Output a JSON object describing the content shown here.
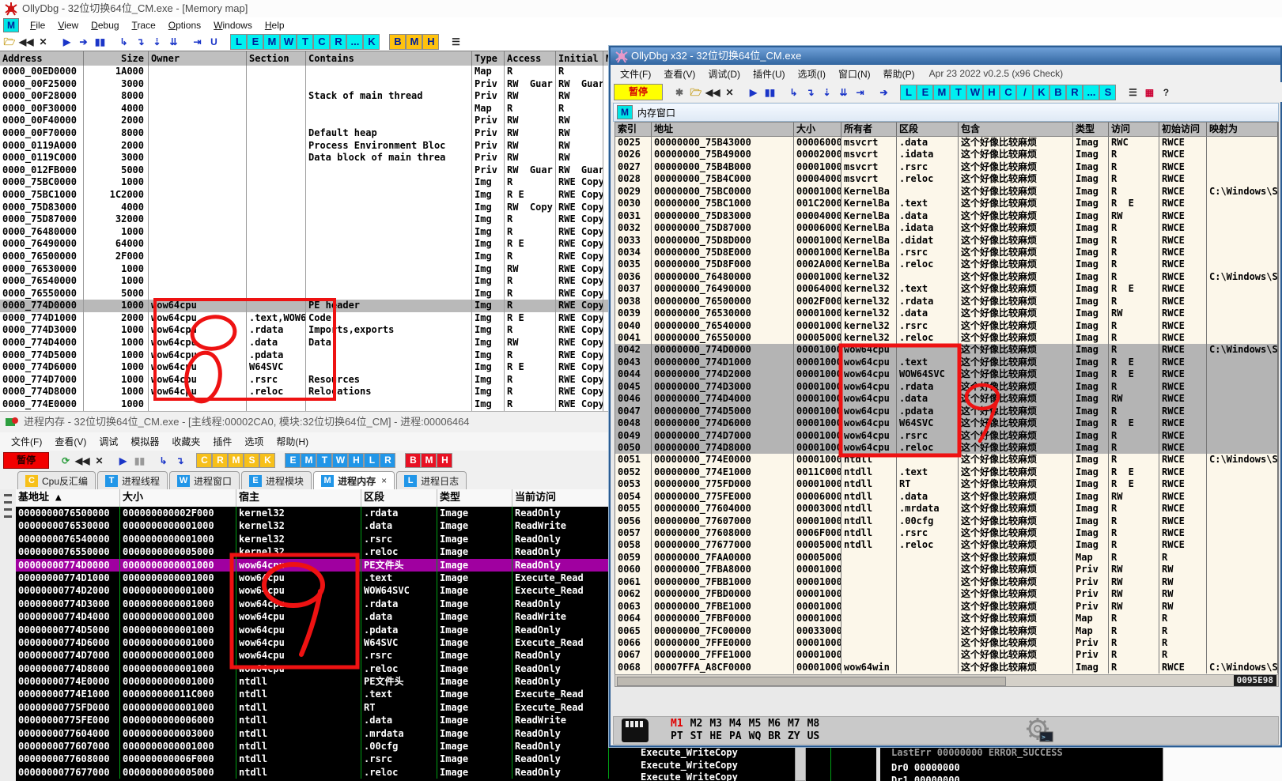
{
  "window_a": {
    "title": "OllyDbg - 32位切换64位_CM.exe - [Memory map]",
    "mdi_button": "M",
    "menu": [
      "File",
      "View",
      "Debug",
      "Trace",
      "Options",
      "Windows",
      "Help"
    ],
    "btn_cyan": [
      "L",
      "E",
      "M",
      "W",
      "T",
      "C",
      "R",
      "...",
      "K"
    ],
    "btn_yellow": [
      "B",
      "M",
      "H"
    ],
    "columns": [
      "Address",
      "Size",
      "Owner",
      "Section",
      "Contains",
      "Type",
      "Access",
      "Initial",
      "Ma"
    ],
    "selected": [
      19
    ],
    "rows": [
      [
        "0000_00ED0000",
        "1A000",
        "",
        "",
        "",
        "Map",
        "R",
        "R"
      ],
      [
        "0000_00F25000",
        "3000",
        "",
        "",
        "",
        "Priv",
        "RW  Guar",
        "RW  Guar"
      ],
      [
        "0000_00F28000",
        "8000",
        "",
        "",
        "Stack of main thread",
        "Priv",
        "RW",
        "RW"
      ],
      [
        "0000_00F30000",
        "4000",
        "",
        "",
        "",
        "Map",
        "R",
        "R"
      ],
      [
        "0000_00F40000",
        "2000",
        "",
        "",
        "",
        "Priv",
        "RW",
        "RW"
      ],
      [
        "0000_00F70000",
        "8000",
        "",
        "",
        "Default heap",
        "Priv",
        "RW",
        "RW"
      ],
      [
        "0000_0119A000",
        "2000",
        "",
        "",
        "Process Environment Bloc",
        "Priv",
        "RW",
        "RW"
      ],
      [
        "0000_0119C000",
        "3000",
        "",
        "",
        "Data block of main threa",
        "Priv",
        "RW",
        "RW"
      ],
      [
        "0000_012FB000",
        "5000",
        "",
        "",
        "",
        "Priv",
        "RW  Guar",
        "RW  Guar"
      ],
      [
        "0000_75BC0000",
        "1000",
        "",
        "",
        "",
        "Img",
        "R",
        "RWE Copy"
      ],
      [
        "0000_75BC1000",
        "1C2000",
        "",
        "",
        "",
        "Img",
        "R E",
        "RWE Copy"
      ],
      [
        "0000_75D83000",
        "4000",
        "",
        "",
        "",
        "Img",
        "RW  Copy",
        "RWE Copy"
      ],
      [
        "0000_75D87000",
        "32000",
        "",
        "",
        "",
        "Img",
        "R",
        "RWE Copy"
      ],
      [
        "0000_76480000",
        "1000",
        "",
        "",
        "",
        "Img",
        "R",
        "RWE Copy"
      ],
      [
        "0000_76490000",
        "64000",
        "",
        "",
        "",
        "Img",
        "R E",
        "RWE Copy"
      ],
      [
        "0000_76500000",
        "2F000",
        "",
        "",
        "",
        "Img",
        "R",
        "RWE Copy"
      ],
      [
        "0000_76530000",
        "1000",
        "",
        "",
        "",
        "Img",
        "RW",
        "RWE Copy"
      ],
      [
        "0000_76540000",
        "1000",
        "",
        "",
        "",
        "Img",
        "R",
        "RWE Copy"
      ],
      [
        "0000_76550000",
        "5000",
        "",
        "",
        "",
        "Img",
        "R",
        "RWE Copy"
      ],
      [
        "0000_774D0000",
        "1000",
        "wow64cpu",
        "",
        "PE header",
        "Img",
        "R",
        "RWE Copy"
      ],
      [
        "0000_774D1000",
        "2000",
        "wow64cpu",
        ".text,WOW6",
        "Code",
        "Img",
        "R E",
        "RWE Copy"
      ],
      [
        "0000_774D3000",
        "1000",
        "wow64cpu",
        ".rdata",
        "Imports,exports",
        "Img",
        "R",
        "RWE Copy"
      ],
      [
        "0000_774D4000",
        "1000",
        "wow64cpu",
        ".data",
        "Data",
        "Img",
        "RW",
        "RWE Copy"
      ],
      [
        "0000_774D5000",
        "1000",
        "wow64cpu",
        ".pdata",
        "",
        "Img",
        "R",
        "RWE Copy"
      ],
      [
        "0000_774D6000",
        "1000",
        "wow64cpu",
        "W64SVC",
        "",
        "Img",
        "R E",
        "RWE Copy"
      ],
      [
        "0000_774D7000",
        "1000",
        "wow64cpu",
        ".rsrc",
        "Resources",
        "Img",
        "R",
        "RWE Copy"
      ],
      [
        "0000_774D8000",
        "1000",
        "wow64cpu",
        ".reloc",
        "Relocations",
        "Img",
        "R",
        "RWE Copy"
      ],
      [
        "0000_774E0000",
        "1000",
        "",
        "",
        "",
        "Img",
        "R",
        "RWE Copy"
      ]
    ]
  },
  "window_b": {
    "title": "进程内存 - 32位切换64位_CM.exe - [主线程:00002CA0, 模块:32位切换64位_CM] - 进程:00006464",
    "menu": [
      "文件(F)",
      "查看(V)",
      "调试",
      "模拟器",
      "收藏夹",
      "插件",
      "选项",
      "帮助(H)"
    ],
    "pause_label": "暂停",
    "btn_yellow": [
      "C",
      "R",
      "M",
      "S",
      "K"
    ],
    "btn_blue": [
      "E",
      "M",
      "T",
      "W",
      "H",
      "L",
      "R"
    ],
    "btn_red": [
      "B",
      "M",
      "H"
    ],
    "back_arrow": "◁",
    "tabs": [
      {
        "letter": "C",
        "label": "Cpu反汇编",
        "color": "yel"
      },
      {
        "letter": "T",
        "label": "进程线程",
        "color": "blu"
      },
      {
        "letter": "W",
        "label": "进程窗口",
        "color": "blu"
      },
      {
        "letter": "E",
        "label": "进程模块",
        "color": "blu"
      },
      {
        "letter": "M",
        "label": "进程内存",
        "color": "blu"
      },
      {
        "letter": "L",
        "label": "进程日志",
        "color": "blu"
      }
    ],
    "active_tab": 4,
    "tab_close": "×",
    "columns": [
      "基地址 ▲",
      "大小",
      "宿主",
      "区段",
      "类型",
      "当前访问"
    ],
    "selected": [
      4
    ],
    "rows": [
      [
        "0000000076500000",
        "000000000002F000",
        "kernel32",
        ".rdata",
        "Image",
        "ReadOnly"
      ],
      [
        "0000000076530000",
        "0000000000001000",
        "kernel32",
        ".data",
        "Image",
        "ReadWrite"
      ],
      [
        "0000000076540000",
        "0000000000001000",
        "kernel32",
        ".rsrc",
        "Image",
        "ReadOnly"
      ],
      [
        "0000000076550000",
        "0000000000005000",
        "kernel32",
        ".reloc",
        "Image",
        "ReadOnly"
      ],
      [
        "00000000774D0000",
        "0000000000001000",
        "wow64cpu",
        "PE文件头",
        "Image",
        "ReadOnly"
      ],
      [
        "00000000774D1000",
        "0000000000001000",
        "wow64cpu",
        ".text",
        "Image",
        "Execute_Read"
      ],
      [
        "00000000774D2000",
        "0000000000001000",
        "wow64cpu",
        "WOW64SVC",
        "Image",
        "Execute_Read"
      ],
      [
        "00000000774D3000",
        "0000000000001000",
        "wow64cpu",
        ".rdata",
        "Image",
        "ReadOnly"
      ],
      [
        "00000000774D4000",
        "0000000000001000",
        "wow64cpu",
        ".data",
        "Image",
        "ReadWrite"
      ],
      [
        "00000000774D5000",
        "0000000000001000",
        "wow64cpu",
        ".pdata",
        "Image",
        "ReadOnly"
      ],
      [
        "00000000774D6000",
        "0000000000001000",
        "wow64cpu",
        "W64SVC",
        "Image",
        "Execute_Read"
      ],
      [
        "00000000774D7000",
        "0000000000001000",
        "wow64cpu",
        ".rsrc",
        "Image",
        "ReadOnly"
      ],
      [
        "00000000774D8000",
        "0000000000001000",
        "wow64cpu",
        ".reloc",
        "Image",
        "ReadOnly"
      ],
      [
        "00000000774E0000",
        "0000000000001000",
        "ntdll",
        "PE文件头",
        "Image",
        "ReadOnly"
      ],
      [
        "00000000774E1000",
        "000000000011C000",
        "ntdll",
        ".text",
        "Image",
        "Execute_Read"
      ],
      [
        "00000000775FD000",
        "0000000000001000",
        "ntdll",
        "RT",
        "Image",
        "Execute_Read"
      ],
      [
        "00000000775FE000",
        "0000000000006000",
        "ntdll",
        ".data",
        "Image",
        "ReadWrite"
      ],
      [
        "0000000077604000",
        "0000000000003000",
        "ntdll",
        ".mrdata",
        "Image",
        "ReadOnly"
      ],
      [
        "0000000077607000",
        "0000000000001000",
        "ntdll",
        ".00cfg",
        "Image",
        "ReadOnly"
      ],
      [
        "0000000077608000",
        "000000000006F000",
        "ntdll",
        ".rsrc",
        "Image",
        "ReadOnly"
      ],
      [
        "0000000077677000",
        "0000000000005000",
        "ntdll",
        ".reloc",
        "Image",
        "ReadOnly"
      ]
    ]
  },
  "window_c": {
    "title": "OllyDbg x32 - 32位切换64位_CM.exe",
    "menu": [
      "文件(F)",
      "查看(V)",
      "调试(D)",
      "插件(U)",
      "选项(I)",
      "窗口(N)",
      "帮助(P)"
    ],
    "version": "Apr 23 2022  v0.2.5 (x96 Check)",
    "pause_label": "暂停",
    "btn_cyan": [
      "L",
      "E",
      "M",
      "T",
      "W",
      "H",
      "C",
      "/",
      "K",
      "B",
      "R",
      "...",
      "S"
    ],
    "child_tab_letter": "M",
    "child_tab_label": "内存窗口",
    "columns": [
      "索引",
      "地址",
      "大小",
      "所有者",
      "区段",
      "包含",
      "类型",
      "访问",
      "初始访问",
      "映射为"
    ],
    "contains_all": "这个好像比较麻烦",
    "scroll_value": "0095E98",
    "selected": [
      17,
      18,
      19,
      20,
      21,
      22,
      23,
      24,
      25
    ],
    "bottom_tabs_m": [
      "M1",
      "M2",
      "M3",
      "M4",
      "M5",
      "M6",
      "M7",
      "M8"
    ],
    "bottom_tabs_p": [
      "PT",
      "ST",
      "HE",
      "PA",
      "WQ",
      "BR",
      "ZY",
      "US"
    ],
    "rows": [
      [
        "0025",
        "00000000_75B43000",
        "00006000",
        "msvcrt",
        ".data",
        "Imag",
        "RWC",
        "RWCE",
        ""
      ],
      [
        "0026",
        "00000000_75B49000",
        "00002000",
        "msvcrt",
        ".idata",
        "Imag",
        "R",
        "RWCE",
        ""
      ],
      [
        "0027",
        "00000000_75B4B000",
        "00001000",
        "msvcrt",
        ".rsrc",
        "Imag",
        "R",
        "RWCE",
        ""
      ],
      [
        "0028",
        "00000000_75B4C000",
        "00004000",
        "msvcrt",
        ".reloc",
        "Imag",
        "R",
        "RWCE",
        ""
      ],
      [
        "0029",
        "00000000_75BC0000",
        "00001000",
        "KernelBa",
        "",
        "Imag",
        "R",
        "RWCE",
        "C:\\Windows\\S"
      ],
      [
        "0030",
        "00000000_75BC1000",
        "001C2000",
        "KernelBa",
        ".text",
        "Imag",
        "R  E",
        "RWCE",
        ""
      ],
      [
        "0031",
        "00000000_75D83000",
        "00004000",
        "KernelBa",
        ".data",
        "Imag",
        "RW",
        "RWCE",
        ""
      ],
      [
        "0032",
        "00000000_75D87000",
        "00006000",
        "KernelBa",
        ".idata",
        "Imag",
        "R",
        "RWCE",
        ""
      ],
      [
        "0033",
        "00000000_75D8D000",
        "00001000",
        "KernelBa",
        ".didat",
        "Imag",
        "R",
        "RWCE",
        ""
      ],
      [
        "0034",
        "00000000_75D8E000",
        "00001000",
        "KernelBa",
        ".rsrc",
        "Imag",
        "R",
        "RWCE",
        ""
      ],
      [
        "0035",
        "00000000_75D8F000",
        "0002A000",
        "KernelBa",
        ".reloc",
        "Imag",
        "R",
        "RWCE",
        ""
      ],
      [
        "0036",
        "00000000_76480000",
        "00001000",
        "kernel32",
        "",
        "Imag",
        "R",
        "RWCE",
        "C:\\Windows\\S"
      ],
      [
        "0037",
        "00000000_76490000",
        "00064000",
        "kernel32",
        ".text",
        "Imag",
        "R  E",
        "RWCE",
        ""
      ],
      [
        "0038",
        "00000000_76500000",
        "0002F000",
        "kernel32",
        ".rdata",
        "Imag",
        "R",
        "RWCE",
        ""
      ],
      [
        "0039",
        "00000000_76530000",
        "00001000",
        "kernel32",
        ".data",
        "Imag",
        "RW",
        "RWCE",
        ""
      ],
      [
        "0040",
        "00000000_76540000",
        "00001000",
        "kernel32",
        ".rsrc",
        "Imag",
        "R",
        "RWCE",
        ""
      ],
      [
        "0041",
        "00000000_76550000",
        "00005000",
        "kernel32",
        ".reloc",
        "Imag",
        "R",
        "RWCE",
        ""
      ],
      [
        "0042",
        "00000000_774D0000",
        "00001000",
        "wow64cpu",
        "",
        "Imag",
        "R",
        "RWCE",
        "C:\\Windows\\S"
      ],
      [
        "0043",
        "00000000_774D1000",
        "00001000",
        "wow64cpu",
        ".text",
        "Imag",
        "R  E",
        "RWCE",
        ""
      ],
      [
        "0044",
        "00000000_774D2000",
        "00001000",
        "wow64cpu",
        "WOW64SVC",
        "Imag",
        "R  E",
        "RWCE",
        ""
      ],
      [
        "0045",
        "00000000_774D3000",
        "00001000",
        "wow64cpu",
        ".rdata",
        "Imag",
        "R",
        "RWCE",
        ""
      ],
      [
        "0046",
        "00000000_774D4000",
        "00001000",
        "wow64cpu",
        ".data",
        "Imag",
        "RW",
        "RWCE",
        ""
      ],
      [
        "0047",
        "00000000_774D5000",
        "00001000",
        "wow64cpu",
        ".pdata",
        "Imag",
        "R",
        "RWCE",
        ""
      ],
      [
        "0048",
        "00000000_774D6000",
        "00001000",
        "wow64cpu",
        "W64SVC",
        "Imag",
        "R  E",
        "RWCE",
        ""
      ],
      [
        "0049",
        "00000000_774D7000",
        "00001000",
        "wow64cpu",
        ".rsrc",
        "Imag",
        "R",
        "RWCE",
        ""
      ],
      [
        "0050",
        "00000000_774D8000",
        "00001000",
        "wow64cpu",
        ".reloc",
        "Imag",
        "R",
        "RWCE",
        ""
      ],
      [
        "0051",
        "00000000_774E0000",
        "00001000",
        "ntdll",
        "",
        "Imag",
        "R",
        "RWCE",
        "C:\\Windows\\S"
      ],
      [
        "0052",
        "00000000_774E1000",
        "0011C000",
        "ntdll",
        ".text",
        "Imag",
        "R  E",
        "RWCE",
        ""
      ],
      [
        "0053",
        "00000000_775FD000",
        "00001000",
        "ntdll",
        "RT",
        "Imag",
        "R  E",
        "RWCE",
        ""
      ],
      [
        "0054",
        "00000000_775FE000",
        "00006000",
        "ntdll",
        ".data",
        "Imag",
        "RW",
        "RWCE",
        ""
      ],
      [
        "0055",
        "00000000_77604000",
        "00003000",
        "ntdll",
        ".mrdata",
        "Imag",
        "R",
        "RWCE",
        ""
      ],
      [
        "0056",
        "00000000_77607000",
        "00001000",
        "ntdll",
        ".00cfg",
        "Imag",
        "R",
        "RWCE",
        ""
      ],
      [
        "0057",
        "00000000_77608000",
        "0006F000",
        "ntdll",
        ".rsrc",
        "Imag",
        "R",
        "RWCE",
        ""
      ],
      [
        "0058",
        "00000000_77677000",
        "00005000",
        "ntdll",
        ".reloc",
        "Imag",
        "R",
        "RWCE",
        ""
      ],
      [
        "0059",
        "00000000_7FAA0000",
        "00005000",
        "",
        "",
        "Map",
        "R",
        "R",
        ""
      ],
      [
        "0060",
        "00000000_7FBA8000",
        "00001000",
        "",
        "",
        "Priv",
        "RW",
        "RW",
        ""
      ],
      [
        "0061",
        "00000000_7FBB1000",
        "00001000",
        "",
        "",
        "Priv",
        "RW",
        "RW",
        ""
      ],
      [
        "0062",
        "00000000_7FBD0000",
        "00001000",
        "",
        "",
        "Priv",
        "RW",
        "RW",
        ""
      ],
      [
        "0063",
        "00000000_7FBE1000",
        "00001000",
        "",
        "",
        "Priv",
        "RW",
        "RW",
        ""
      ],
      [
        "0064",
        "00000000_7FBF0000",
        "00001000",
        "",
        "",
        "Map",
        "R",
        "R",
        ""
      ],
      [
        "0065",
        "00000000_7FC00000",
        "00033000",
        "",
        "",
        "Map",
        "R",
        "R",
        ""
      ],
      [
        "0066",
        "00000000_7FFE0000",
        "00001000",
        "",
        "",
        "Priv",
        "R",
        "R",
        ""
      ],
      [
        "0067",
        "00000000_7FFE1000",
        "00001000",
        "",
        "",
        "Priv",
        "R",
        "R",
        ""
      ],
      [
        "0068",
        "00007FFA_A8CF0000",
        "00001000",
        "wow64win",
        "",
        "Imag",
        "R",
        "RWCE",
        "C:\\Windows\\S"
      ]
    ]
  },
  "background": {
    "exec_rows": [
      "Execute_WriteCopy",
      "Execute_WriteCopy",
      "Execute_WriteCopy"
    ],
    "lasterr": "LastErr  00000000 ERROR_SUCCESS",
    "dr0": "Dr0 00000000",
    "dr1": "Dr1 00000000"
  },
  "annotations": {
    "a_label": "8",
    "b_label": "9",
    "c_label": "9",
    "color": "#ee1212"
  }
}
